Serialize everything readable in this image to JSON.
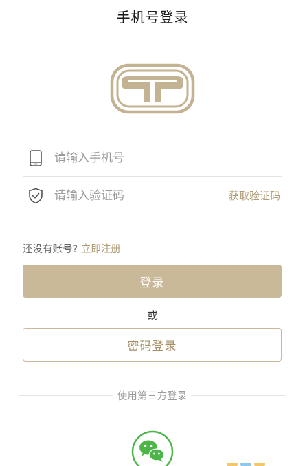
{
  "header": {
    "title": "手机号登录"
  },
  "phone": {
    "placeholder": "请输入手机号"
  },
  "code": {
    "placeholder": "请输入验证码",
    "get_code_label": "获取验证码"
  },
  "register": {
    "prompt": "还没有账号?",
    "link_label": "立即注册"
  },
  "login": {
    "label": "登录"
  },
  "or": {
    "label": "或"
  },
  "password_login": {
    "label": "密码登录"
  },
  "third_party": {
    "label": "使用第三方登录"
  },
  "icons": {
    "phone": "phone-icon",
    "shield": "shield-check-icon",
    "wechat": "wechat-icon",
    "logo": "brand-logo"
  },
  "colors": {
    "accent": "#c9b998",
    "accent_text": "#b09c76",
    "wechat_green": "#4cb648"
  }
}
